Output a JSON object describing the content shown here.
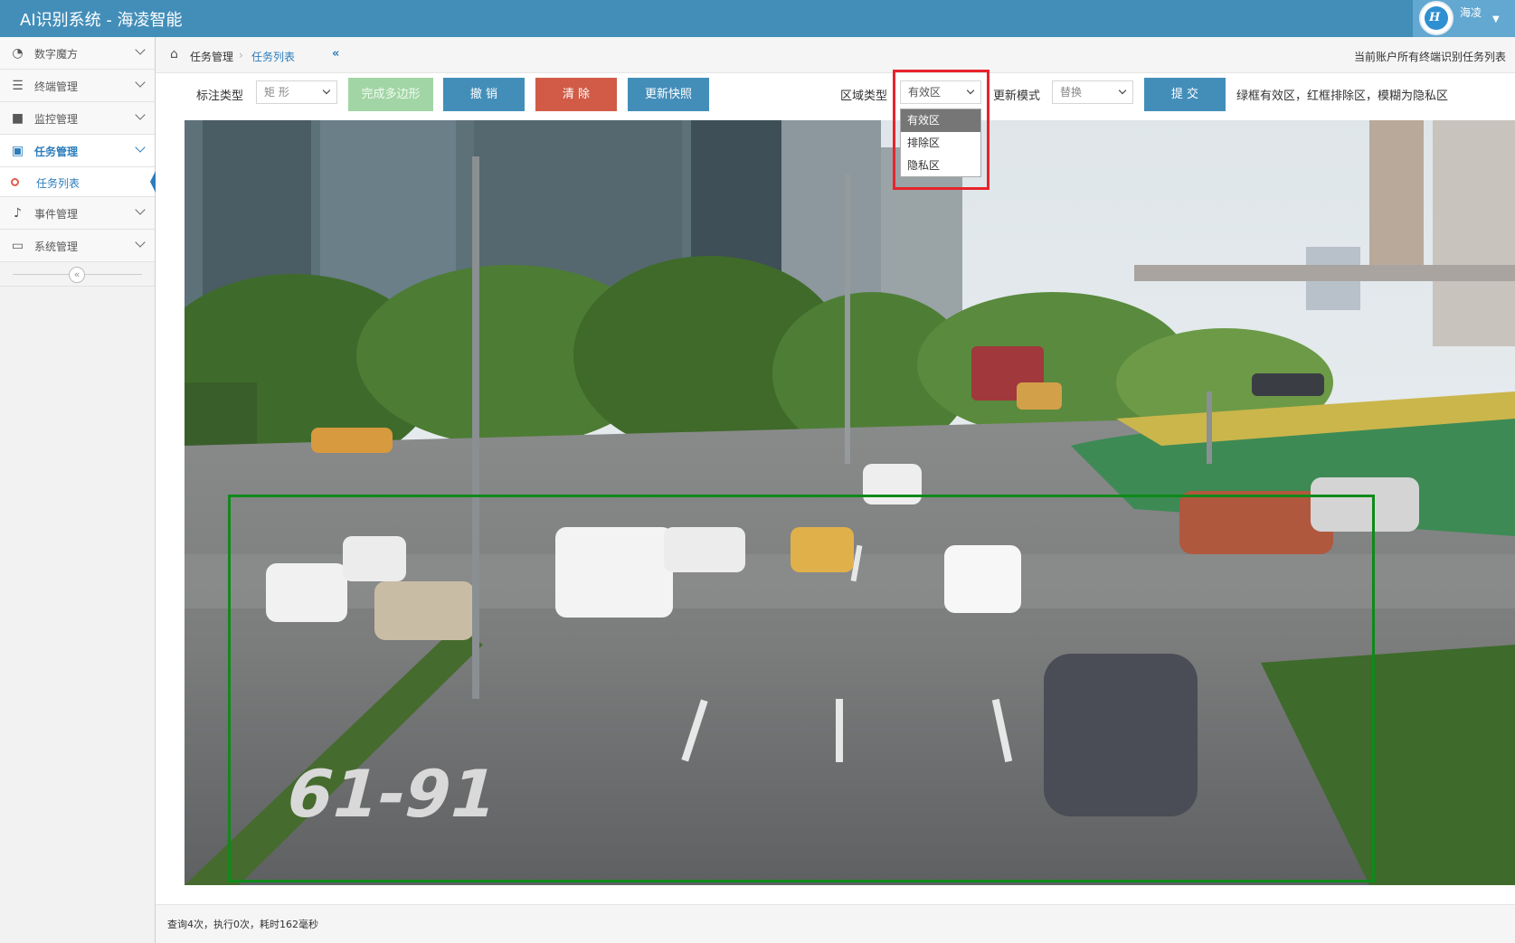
{
  "app": {
    "title": "AI识别系统 - 海凌智能"
  },
  "user": {
    "name": "海凌",
    "avatar_icon": "company-logo-icon"
  },
  "sidebar": {
    "items": [
      {
        "label": "数字魔方",
        "icon": "dashboard-icon"
      },
      {
        "label": "终端管理",
        "icon": "server-icon"
      },
      {
        "label": "监控管理",
        "icon": "video-camera-icon"
      },
      {
        "label": "任务管理",
        "icon": "briefcase-icon",
        "active": true
      },
      {
        "label": "事件管理",
        "icon": "bell-icon"
      },
      {
        "label": "系统管理",
        "icon": "monitor-icon"
      }
    ],
    "sub_items": [
      {
        "label": "任务列表",
        "active": true
      }
    ]
  },
  "breadcrumb": {
    "home_icon": "home-icon",
    "items": [
      "任务管理",
      "任务列表"
    ],
    "right_text": "当前账户所有终端识别任务列表"
  },
  "toolbar": {
    "annotation_type_label": "标注类型",
    "annotation_type_value": "矩 形",
    "finish_polygon_label": "完成多边形",
    "undo_label": "撤 销",
    "clear_label": "清 除",
    "update_snapshot_label": "更新快照",
    "region_type_label": "区域类型",
    "region_type_value": "有效区",
    "update_mode_label": "更新模式",
    "update_mode_value": "替换",
    "submit_label": "提 交",
    "hint": "绿框有效区，红框排除区，模糊为隐私区"
  },
  "region_dropdown": {
    "options": [
      "有效区",
      "排除区",
      "隐私区"
    ],
    "selected": "有效区"
  },
  "scene": {
    "description_colors": {
      "zone_border": "#0f8a1a",
      "road": "#6f7072",
      "trees": "#3f6a2a"
    }
  },
  "footer": {
    "text": "查询4次，执行0次，耗时162毫秒"
  },
  "colors": {
    "topbar": "#438eb9",
    "primary": "#438eb9",
    "danger": "#d15b47",
    "success_light": "#a2d5a5",
    "highlight": "#e8232b"
  }
}
